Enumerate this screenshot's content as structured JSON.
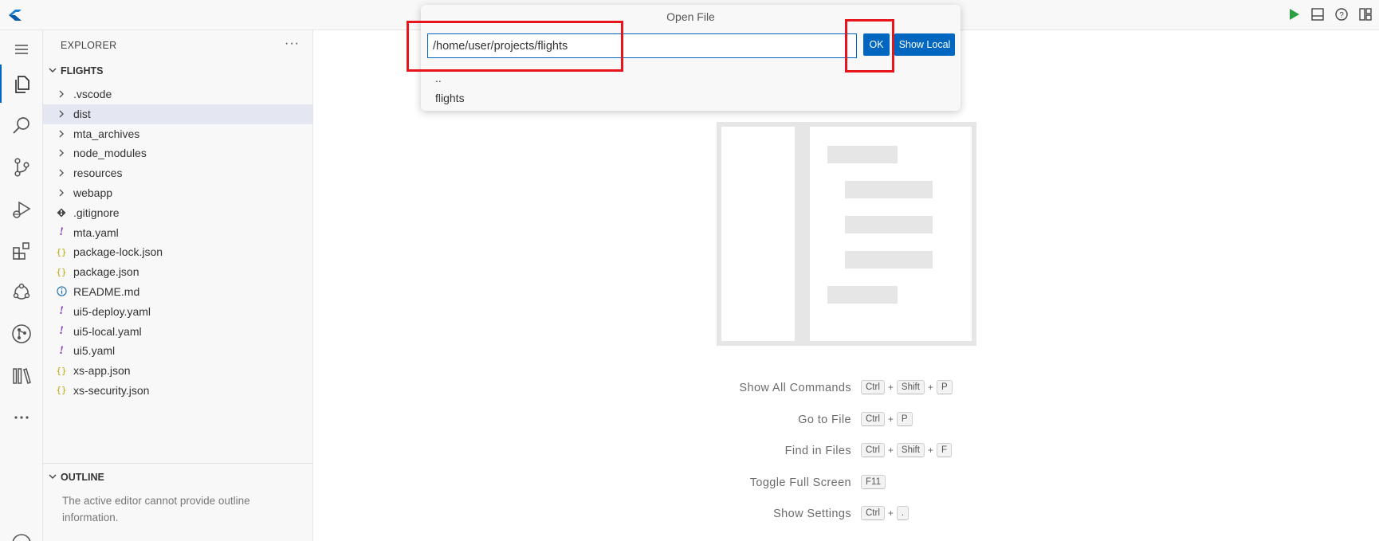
{
  "titlebar": {
    "logo_icon": "app-logo-icon",
    "run_icon": "play-icon",
    "panel_icon": "panel-toggle-icon",
    "help_icon": "help-icon",
    "layout_icon": "layout-icon"
  },
  "activity_bar": {
    "items": [
      {
        "name": "menu-icon"
      },
      {
        "name": "explorer-icon"
      },
      {
        "name": "search-icon"
      },
      {
        "name": "source-control-icon"
      },
      {
        "name": "run-debug-icon"
      },
      {
        "name": "extensions-icon"
      },
      {
        "name": "cloud-foundry-icon"
      },
      {
        "name": "git-graph-icon"
      },
      {
        "name": "library-icon"
      },
      {
        "name": "more-icon"
      }
    ]
  },
  "sidebar": {
    "header": "EXPLORER",
    "more": "···",
    "section_title": "FLIGHTS",
    "tree": [
      {
        "name": ".vscode",
        "icon": "chevron-right"
      },
      {
        "name": "dist",
        "icon": "chevron-right",
        "selected": true
      },
      {
        "name": "mta_archives",
        "icon": "chevron-right"
      },
      {
        "name": "node_modules",
        "icon": "chevron-right"
      },
      {
        "name": "resources",
        "icon": "chevron-right"
      },
      {
        "name": "webapp",
        "icon": "chevron-right"
      },
      {
        "name": ".gitignore",
        "icon": "git"
      },
      {
        "name": "mta.yaml",
        "icon": "yaml"
      },
      {
        "name": "package-lock.json",
        "icon": "json"
      },
      {
        "name": "package.json",
        "icon": "json"
      },
      {
        "name": "README.md",
        "icon": "info"
      },
      {
        "name": "ui5-deploy.yaml",
        "icon": "yaml"
      },
      {
        "name": "ui5-local.yaml",
        "icon": "yaml"
      },
      {
        "name": "ui5.yaml",
        "icon": "yaml"
      },
      {
        "name": "xs-app.json",
        "icon": "json"
      },
      {
        "name": "xs-security.json",
        "icon": "json"
      }
    ],
    "outline": {
      "title": "OUTLINE",
      "message": "The active editor cannot provide outline information."
    }
  },
  "quick_open": {
    "title": "Open File",
    "input_value": "/home/user/projects/flights",
    "ok_label": "OK",
    "show_local_label": "Show Local",
    "items": [
      "..",
      "flights"
    ]
  },
  "editor": {
    "shortcuts": [
      {
        "label": "Show All Commands",
        "keys": [
          "Ctrl",
          "Shift",
          "P"
        ]
      },
      {
        "label": "Go to File",
        "keys": [
          "Ctrl",
          "P"
        ]
      },
      {
        "label": "Find in Files",
        "keys": [
          "Ctrl",
          "Shift",
          "F"
        ]
      },
      {
        "label": "Toggle Full Screen",
        "keys": [
          "F11"
        ]
      },
      {
        "label": "Show Settings",
        "keys": [
          "Ctrl",
          "."
        ]
      }
    ]
  },
  "colors": {
    "accent": "#0066bf",
    "highlight": "#e8141b",
    "run": "#2ea043"
  }
}
